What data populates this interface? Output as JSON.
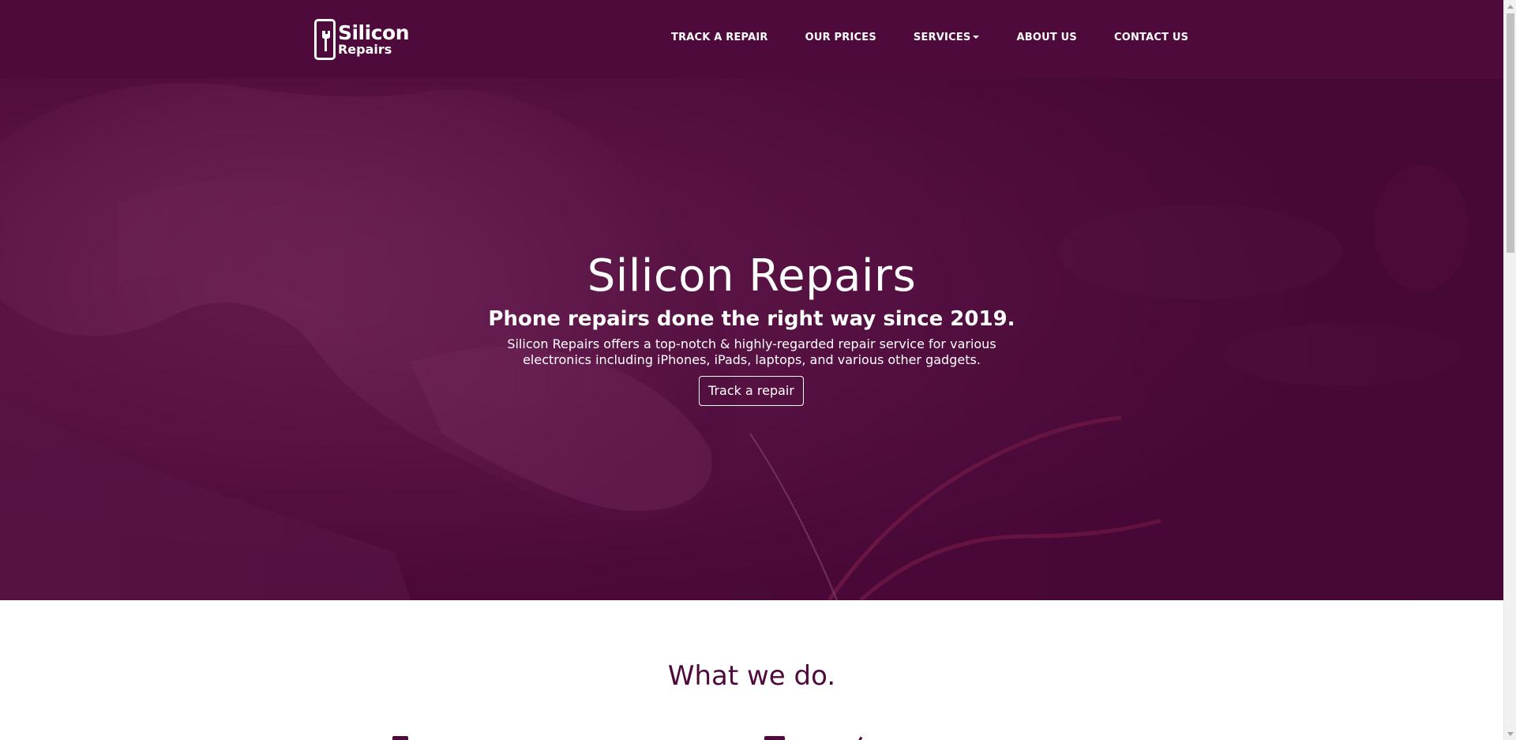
{
  "brand": {
    "line1": "Silicon",
    "line2": "Repairs"
  },
  "nav": {
    "items": [
      {
        "label": "TRACK A REPAIR"
      },
      {
        "label": "OUR PRICES"
      },
      {
        "label": "SERVICES"
      },
      {
        "label": "ABOUT US"
      },
      {
        "label": "CONTACT US"
      }
    ]
  },
  "hero": {
    "title": "Silicon Repairs",
    "subtitle": "Phone repairs done the right way since 2019.",
    "description": "Silicon Repairs offers a top-notch & highly-regarded repair service for various electronics including iPhones, iPads, laptops, and various other gadgets.",
    "button_label": "Track a repair"
  },
  "section": {
    "title": "What we do."
  },
  "colors": {
    "primary": "#4e0a3a",
    "text_light": "#ffffff"
  },
  "icons": {
    "logo": "phone-wrench-icon",
    "dropdown": "caret-down-icon"
  }
}
